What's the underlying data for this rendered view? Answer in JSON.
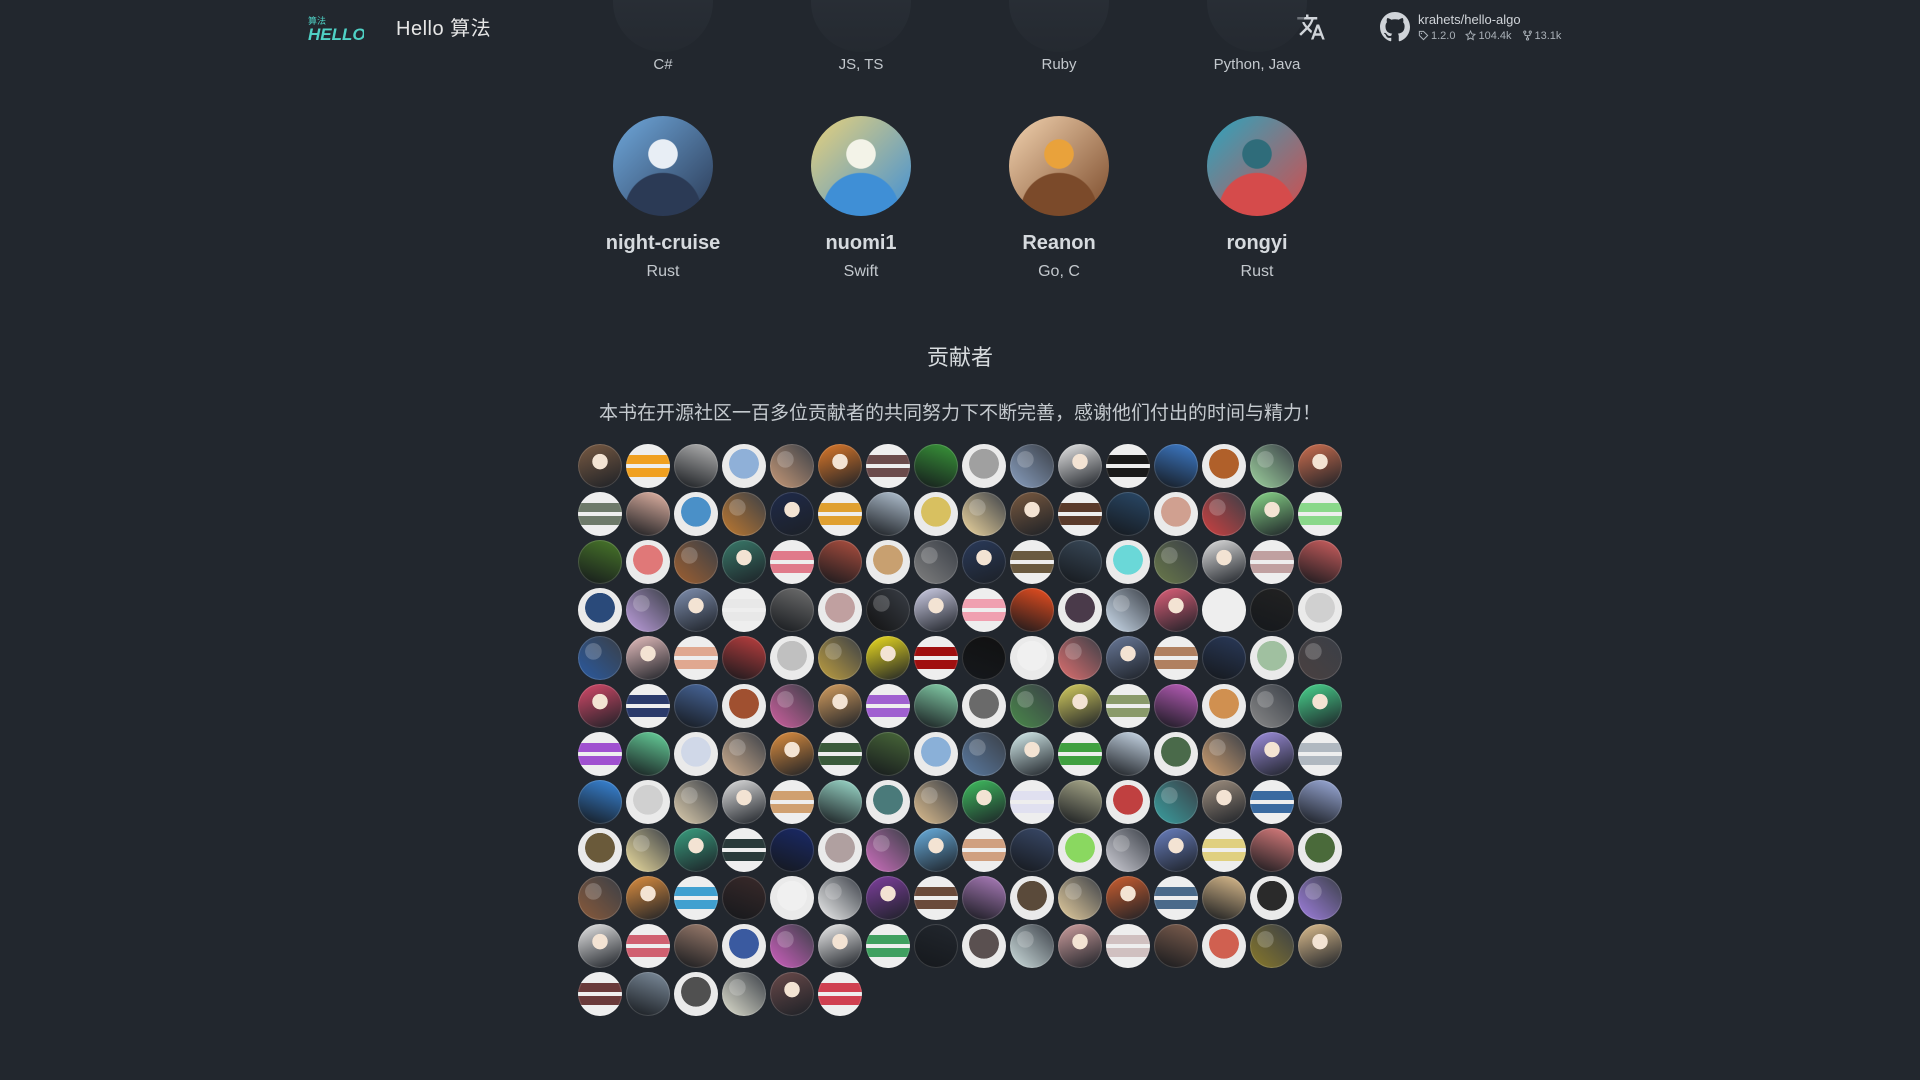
{
  "header": {
    "logo_text": "HELLO 算法",
    "title": "Hello 算法",
    "repo": {
      "name": "krahets/hello-algo",
      "version": "1.2.0",
      "stars": "104.4k",
      "forks": "13.1k"
    }
  },
  "top_row": [
    {
      "lang": "C#"
    },
    {
      "lang": "JS, TS"
    },
    {
      "lang": "Ruby"
    },
    {
      "lang": "Python, Java"
    }
  ],
  "reviewers": [
    {
      "name": "night-cruise",
      "lang": "Rust",
      "colors": [
        "#6fa8dc",
        "#2b3a55",
        "#e8eef5"
      ]
    },
    {
      "name": "nuomi1",
      "lang": "Swift",
      "colors": [
        "#e9d27a",
        "#3f8fd6",
        "#f3f3e8"
      ]
    },
    {
      "name": "Reanon",
      "lang": "Go, C",
      "colors": [
        "#f2d3b0",
        "#7b4a2a",
        "#e9a23b"
      ]
    },
    {
      "name": "rongyi",
      "lang": "Rust",
      "colors": [
        "#2aa6c0",
        "#d54b4b",
        "#2f6c7a"
      ]
    }
  ],
  "contributors": {
    "title": "贡献者",
    "description": "本书在开源社区一百多位贡献者的共同努力下不断完善，感谢他们付出的时间与精力！",
    "avatars": [
      "#7a5b43",
      "#f0a020",
      "#b8b8b8",
      "#8fb0d8",
      "#c89a78",
      "#e07a2a",
      "#6b4b4b",
      "#3a9a3a",
      "#a0a0a0",
      "#8aa0c0",
      "#e8e8e8",
      "#1a1a1a",
      "#3f7fd0",
      "#b0602a",
      "#9fd39f",
      "#d07050",
      "#6e7a6a",
      "#e8b8a8",
      "#4a90c8",
      "#c07a30",
      "#1f2a4a",
      "#e0a030",
      "#b8c8d8",
      "#d8c060",
      "#f0d8a0",
      "#7a5a40",
      "#5a3a2a",
      "#2a4a6a",
      "#d0a090",
      "#d04040",
      "#8ad88a",
      "#8ad88a",
      "#4a7a2a",
      "#e07878",
      "#a06030",
      "#3a7a6a",
      "#e07a8a",
      "#b05040",
      "#c8a070",
      "#808080",
      "#2a3a5a",
      "#6a5a40",
      "#3a4a5a",
      "#6ad8d8",
      "#6a7a4a",
      "#e0e0e0",
      "#c0a0a0",
      "#d06060",
      "#2a4a7a",
      "#c0a0e0",
      "#8090b0",
      "#e8e8e8",
      "#707070",
      "#c0a0a0",
      "#111111",
      "#d0d0e8",
      "#f0a0b0",
      "#f05020",
      "#4a3a4a",
      "#d0e0f0",
      "#e0607a",
      "#eeeeee",
      "#222222",
      "#d0d0d0",
      "#2a5aa0",
      "#e8c0c0",
      "#e0a890",
      "#c04040",
      "#c0c0c0",
      "#c0a040",
      "#f0e020",
      "#a01010",
      "#111111",
      "#f0f0f0",
      "#e07070",
      "#6a7a9a",
      "#b08060",
      "#2a3a5a",
      "#a0c0a0",
      "#4a4040",
      "#d84a6a",
      "#2a3a6a",
      "#4a6aa0",
      "#a05030",
      "#d060a0",
      "#d8a060",
      "#a060d0",
      "#8ad8b0",
      "#6a6a6a",
      "#4a8a4a",
      "#d8d060",
      "#8a9a6a",
      "#c060c0",
      "#d09050",
      "#8a8a8a",
      "#4ad890",
      "#a050d0",
      "#6ad8a0",
      "#d0d8e8",
      "#d0b090",
      "#e09040",
      "#3a5a3a",
      "#4a6a3a",
      "#8ab0d8",
      "#5a7aa0",
      "#d8f0f0",
      "#40a040",
      "#d0e0f0",
      "#4a6a4a",
      "#d0a070",
      "#a090e0",
      "#b0b8c0",
      "#3a8ae0",
      "#d0d0d0",
      "#e0d0b0",
      "#e0e0e0",
      "#d0a070",
      "#a0e0d0",
      "#4a7a7a",
      "#e0c090",
      "#40c060",
      "#e0e0f0",
      "#b0b090",
      "#c04040",
      "#3aa0a0",
      "#a09080",
      "#3a6aa0",
      "#a0b0e0",
      "#6a5a3a",
      "#f0e0a0",
      "#3aa080",
      "#2a3a3a",
      "#1a2a6a",
      "#b0a0a0",
      "#d070c0",
      "#6ab0e0",
      "#d0a080",
      "#3a4a6a",
      "#8ad860",
      "#d0d0d8",
      "#6a80c0",
      "#e0d080",
      "#e08080",
      "#4a6a3a",
      "#8a5a3a",
      "#e09040",
      "#40a0d0",
      "#3a2a2a",
      "#f0f0f0",
      "#f0f0f0",
      "#8040a0",
      "#6a4a3a",
      "#b080c0",
      "#5a4a3a",
      "#e8d0a0",
      "#d06030",
      "#4a6a8a",
      "#e0c090",
      "#2a2a2a",
      "#a080e0",
      "#e8e8e8",
      "#d06070",
      "#a08070",
      "#3a5aa0",
      "#d060c0",
      "#f0f0f0",
      "#40a060",
      "#22272e",
      "#5a5050",
      "#d0e0e0",
      "#d0a0a0",
      "#d0c0c0",
      "#806050",
      "#d06050",
      "#8a7a2a",
      "#e0c090",
      "#6a3a3a",
      "#8090a0",
      "#505050",
      "#e0e0d0",
      "#6a4a4a",
      "#d04050"
    ]
  }
}
